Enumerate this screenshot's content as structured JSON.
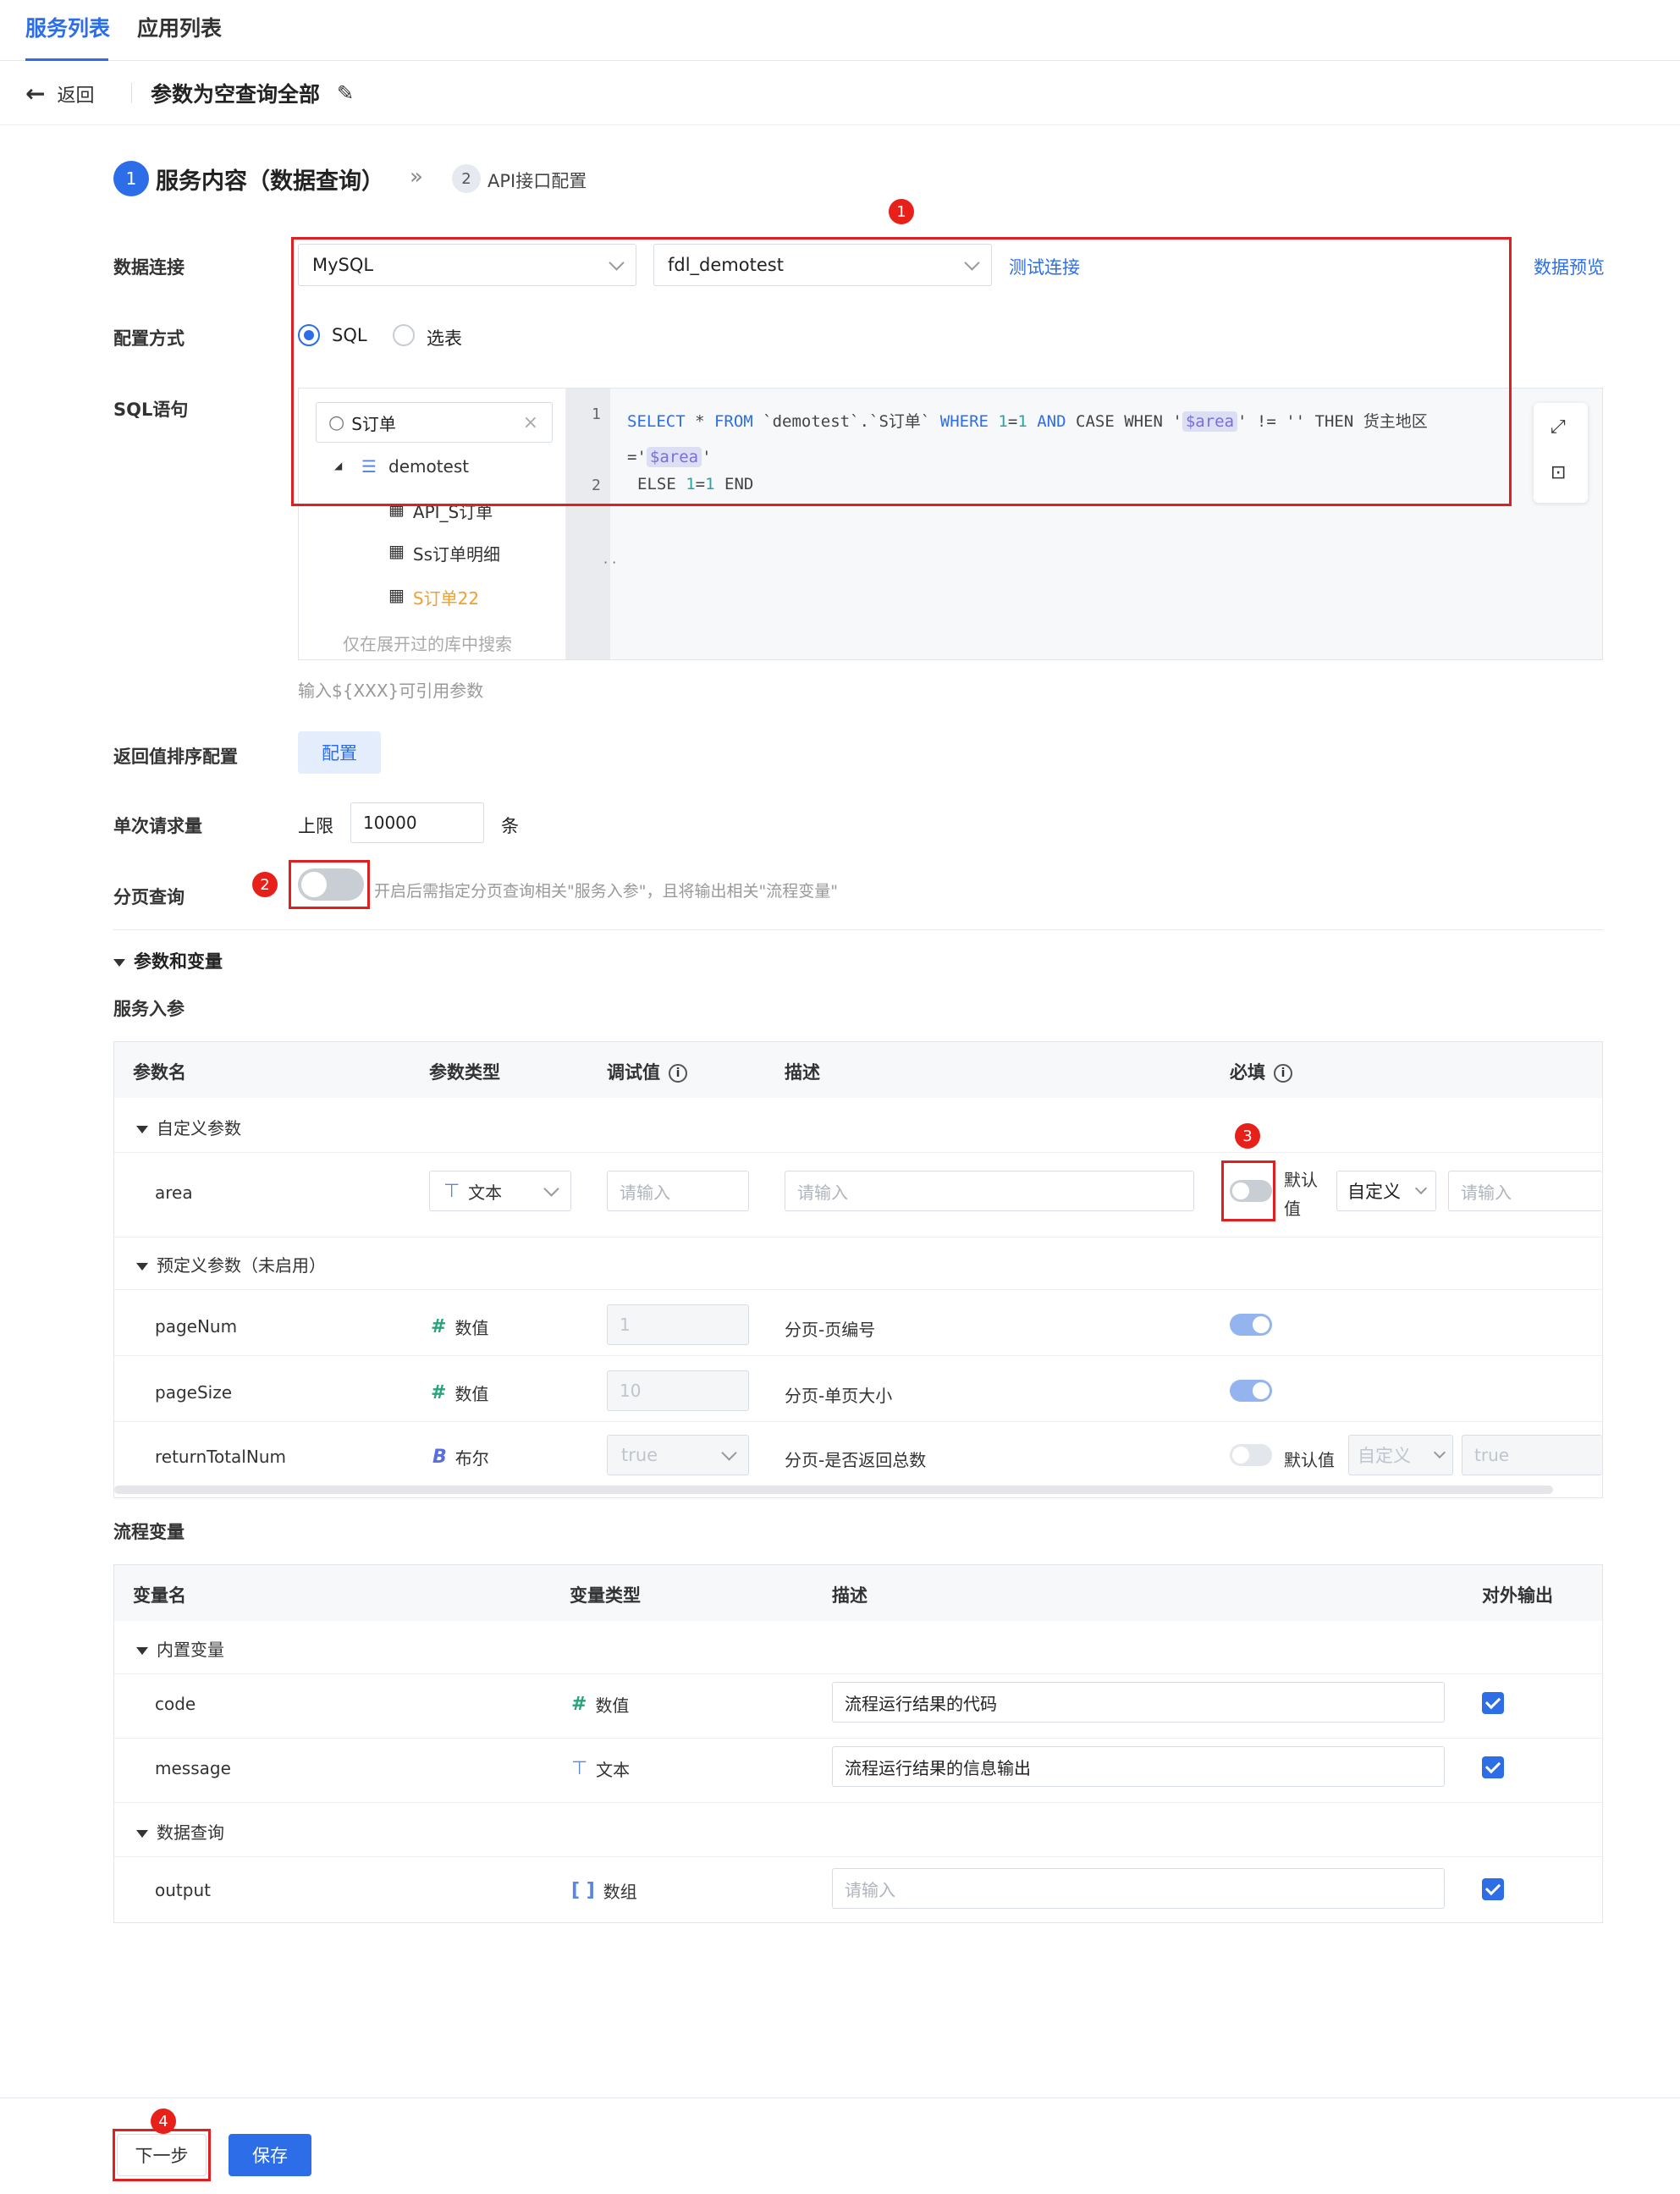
{
  "tabs": {
    "t1": "服务列表",
    "t2": "应用列表"
  },
  "header": {
    "back": "返回",
    "title": "参数为空查询全部"
  },
  "steps": {
    "s1_num": "1",
    "s1_label": "服务内容（数据查询）",
    "s2_num": "2",
    "s2_label": "API接口配置"
  },
  "badges": {
    "b1": "1",
    "b2": "2",
    "b3": "3",
    "b4": "4"
  },
  "form": {
    "data_conn_label": "数据连接",
    "db_type": "MySQL",
    "db_name": "fdl_demotest",
    "test_conn": "测试连接",
    "preview": "数据预览",
    "config_label": "配置方式",
    "opt_sql": "SQL",
    "opt_table": "选表",
    "sql_label": "SQL语句",
    "search_value": "S订单",
    "db_node": "demotest",
    "tables": [
      "API_S订单",
      "Ss订单明细",
      "S订单22"
    ],
    "tree_hint": "仅在展开过的库中搜索",
    "code_line1": "1",
    "code_line2": "2",
    "hint": "输入${XXX}可引用参数",
    "sort_label": "返回值排序配置",
    "sort_btn": "配置",
    "limit_label": "单次请求量",
    "limit_prefix": "上限",
    "limit_value": "10000",
    "limit_unit": "条",
    "page_label": "分页查询",
    "page_hint": "开启后需指定分页查询相关\"服务入参\"，且将输出相关\"流程变量\""
  },
  "section": {
    "params_vars": "参数和变量",
    "service_in": "服务入参",
    "flow_vars": "流程变量"
  },
  "params_table": {
    "h_name": "参数名",
    "h_type": "参数类型",
    "h_debug": "调试值",
    "h_desc": "描述",
    "h_required": "必填",
    "g_custom": "自定义参数",
    "g_predefined": "预定义参数（未启用）",
    "area": {
      "name": "area",
      "type": "文本",
      "debug_ph": "请输入",
      "desc_ph": "请输入",
      "default_label": "默认值",
      "default_mode": "自定义",
      "default_ph": "请输入"
    },
    "pageNum": {
      "name": "pageNum",
      "type": "数值",
      "debug": "1",
      "desc": "分页-页编号"
    },
    "pageSize": {
      "name": "pageSize",
      "type": "数值",
      "debug": "10",
      "desc": "分页-单页大小"
    },
    "returnTotalNum": {
      "name": "returnTotalNum",
      "type": "布尔",
      "debug": "true",
      "desc": "分页-是否返回总数",
      "default_label": "默认值",
      "default_mode": "自定义",
      "default_value": "true"
    }
  },
  "vars_table": {
    "h_name": "变量名",
    "h_type": "变量类型",
    "h_desc": "描述",
    "h_out": "对外输出",
    "g_builtin": "内置变量",
    "g_query": "数据查询",
    "code": {
      "name": "code",
      "type": "数值",
      "desc": "流程运行结果的代码"
    },
    "message": {
      "name": "message",
      "type": "文本",
      "desc": "流程运行结果的信息输出"
    },
    "output": {
      "name": "output",
      "type": "数组",
      "desc_ph": "请输入"
    }
  },
  "footer": {
    "next": "下一步",
    "save": "保存"
  },
  "colors": {
    "accent": "#2d6ee8",
    "annotation_red": "#e02020"
  }
}
